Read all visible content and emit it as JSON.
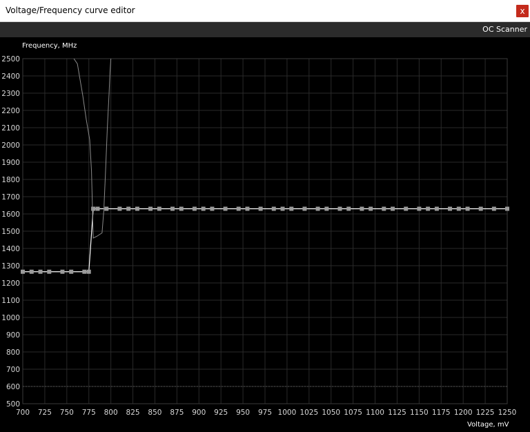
{
  "window": {
    "title": "Voltage/Frequency curve editor",
    "close_label": "x",
    "close_color": "#c42b1c"
  },
  "toolbar": {
    "oc_scanner_label": "OC Scanner"
  },
  "chart_data": {
    "type": "line",
    "title": "",
    "ylabel": "Frequency, MHz",
    "xlabel": "Voltage, mV",
    "xlim": [
      700,
      1250
    ],
    "ylim": [
      500,
      2500
    ],
    "xticks": [
      700,
      725,
      750,
      775,
      800,
      825,
      850,
      875,
      900,
      925,
      950,
      975,
      1000,
      1025,
      1050,
      1075,
      1100,
      1125,
      1150,
      1175,
      1200,
      1225,
      1250
    ],
    "yticks": [
      2500,
      2400,
      2300,
      2200,
      2100,
      2000,
      1900,
      1800,
      1700,
      1600,
      1500,
      1400,
      1300,
      1200,
      1100,
      1000,
      900,
      800,
      700,
      600,
      500
    ],
    "grid": true,
    "reference_line": {
      "y": 600,
      "style": "dotted",
      "color": "#555555"
    },
    "series": [
      {
        "role": "vf-curve",
        "color": "#ffffff",
        "point_color": "#9a9a9a",
        "x": [
          700,
          710,
          720,
          730,
          745,
          755,
          770,
          775,
          780,
          785,
          795,
          810,
          820,
          830,
          845,
          855,
          870,
          880,
          895,
          905,
          915,
          930,
          945,
          955,
          970,
          985,
          995,
          1005,
          1020,
          1035,
          1045,
          1060,
          1070,
          1085,
          1095,
          1110,
          1120,
          1135,
          1150,
          1160,
          1170,
          1185,
          1195,
          1205,
          1220,
          1235,
          1250
        ],
        "y": [
          1265,
          1265,
          1265,
          1265,
          1265,
          1265,
          1265,
          1265,
          1630,
          1630,
          1630,
          1630,
          1630,
          1630,
          1630,
          1630,
          1630,
          1630,
          1630,
          1630,
          1630,
          1630,
          1630,
          1630,
          1630,
          1630,
          1630,
          1630,
          1630,
          1630,
          1630,
          1630,
          1630,
          1630,
          1630,
          1630,
          1630,
          1630,
          1630,
          1630,
          1630,
          1630,
          1630,
          1630,
          1630,
          1630,
          1630
        ]
      },
      {
        "role": "original-curve",
        "color": "#8a8a8a",
        "x": [
          758,
          762,
          768,
          772,
          776,
          778,
          780,
          784,
          787,
          790,
          792,
          794,
          796,
          798,
          799,
          800
        ],
        "y": [
          2500,
          2470,
          2290,
          2150,
          2030,
          1850,
          1460,
          1470,
          1480,
          1490,
          1620,
          1850,
          2100,
          2300,
          2420,
          2500
        ]
      }
    ]
  }
}
